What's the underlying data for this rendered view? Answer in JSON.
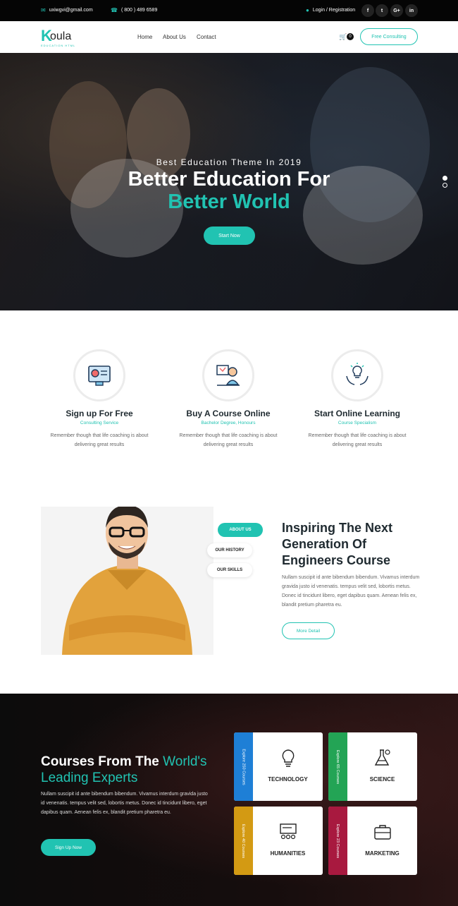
{
  "topbar": {
    "email": "uxiwgvi@gmail.com",
    "phone": "( 800 ) 489 6589",
    "login": "Login / Registration",
    "social": [
      "f",
      "t",
      "G+",
      "in"
    ]
  },
  "nav": {
    "logo_letter": "K",
    "logo_word": "oula",
    "logo_tagline": "EDUCATION HTML",
    "links": [
      "Home",
      "About Us",
      "Contact"
    ],
    "cart_count": "0",
    "consult": "Free Consulting"
  },
  "hero": {
    "subtitle": "Best Education Theme In 2019",
    "title_line1": "Better Education For",
    "title_line2": "Better World",
    "cta": "Start Now"
  },
  "features": [
    {
      "title": "Sign up For Free",
      "sub": "Consulting Service",
      "text": "Remember though that life coaching is about delivering great results"
    },
    {
      "title": "Buy A Course Online",
      "sub": "Bachelor Degree, Honours",
      "text": "Remember though that life coaching is about delivering great results"
    },
    {
      "title": "Start Online Learning",
      "sub": "Course Specialism",
      "text": "Remember though that life coaching is about delivering great results"
    }
  ],
  "about": {
    "tabs": [
      "ABOUT US",
      "OUR HISTORY",
      "OUR SKILLS"
    ],
    "title": "Inspiring The Next Generation Of Engineers Course",
    "text": "Nullam suscipit id ante bibendum bibendum. Vivamus interdum gravida justo id venenatis. tempus velit sed, lobortis metus. Donec id tincidunt libero, eget dapibus quam. Aenean felis ex, blandit pretium pharetra eu.",
    "cta": "More Detail"
  },
  "courses": {
    "title_a": "Courses From The ",
    "title_b": "World's",
    "title_c": "Leading Experts",
    "text": "Nullam suscipit id ante bibendum bibendum. Vivamus interdum gravida justo id venenatis. tempus velit sed, lobortis metus. Donec id tincidunt libero, eget dapibus quam. Aenean felis ex, blandit pretium pharetra eu.",
    "cta": "Sign Up Now",
    "cards": [
      {
        "label": "TECHNOLOGY",
        "strip": "Explore 250 Courses",
        "color": "#1e7fd6"
      },
      {
        "label": "SCIENCE",
        "strip": "Explore 65 Courses",
        "color": "#23a455"
      },
      {
        "label": "HUMANITIES",
        "strip": "Explore 40 Courses",
        "color": "#d39a13"
      },
      {
        "label": "MARKETING",
        "strip": "Explore 23 Courses",
        "color": "#a8193f"
      }
    ]
  },
  "colors": {
    "accent": "#21c3b2",
    "dark": "#050505"
  }
}
